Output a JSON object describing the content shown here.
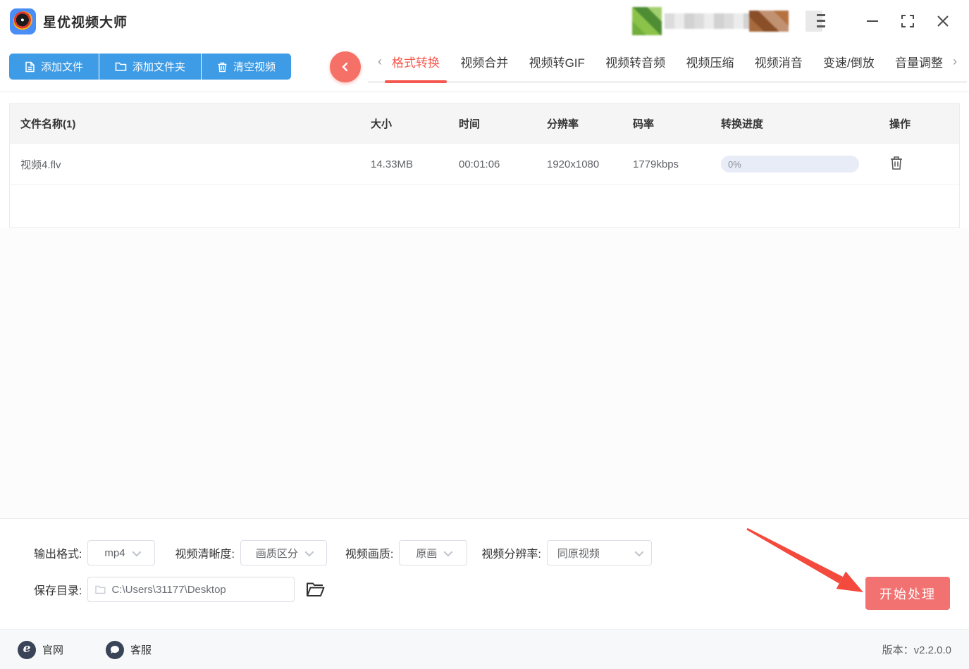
{
  "window": {
    "app_title": "星优视频大师",
    "controls": {
      "minimize": "minimize",
      "maximize": "maximize",
      "close": "close"
    }
  },
  "toolbar": {
    "add_file": "添加文件",
    "add_folder": "添加文件夹",
    "clear_videos": "清空视频"
  },
  "tabs": {
    "scroll_left": "‹",
    "scroll_right": "›",
    "items": [
      {
        "label": "格式转换",
        "active": true
      },
      {
        "label": "视频合并",
        "active": false
      },
      {
        "label": "视频转GIF",
        "active": false
      },
      {
        "label": "视频转音频",
        "active": false
      },
      {
        "label": "视频压缩",
        "active": false
      },
      {
        "label": "视频消音",
        "active": false
      },
      {
        "label": "变速/倒放",
        "active": false
      },
      {
        "label": "音量调整",
        "active": false
      }
    ]
  },
  "table": {
    "headers": [
      "文件名称(1)",
      "大小",
      "时间",
      "分辨率",
      "码率",
      "转换进度",
      "操作"
    ],
    "rows": [
      {
        "name": "视频4.flv",
        "size": "14.33MB",
        "duration": "00:01:06",
        "resolution": "1920x1080",
        "bitrate": "1779kbps",
        "progress_text": "0%",
        "progress_percent": 0
      }
    ]
  },
  "settings": {
    "output_format": {
      "label": "输出格式:",
      "value": "mp4"
    },
    "clarity": {
      "label": "视频清晰度:",
      "value": "画质区分"
    },
    "quality": {
      "label": "视频画质:",
      "value": "原画"
    },
    "resolution": {
      "label": "视频分辨率:",
      "value": "同原视频"
    },
    "save_dir": {
      "label": "保存目录:",
      "value": "C:\\Users\\31177\\Desktop"
    },
    "start_button": "开始处理"
  },
  "footer": {
    "official_site": "官网",
    "support": "客服",
    "version": "版本：v2.2.0.0"
  },
  "colors": {
    "toolbar_blue": "#3e9be5",
    "accent_red": "#f5584e",
    "back_circle_red": "#f57067",
    "start_button_red": "#f27272",
    "arrow_red": "#f4493d",
    "table_header_bg": "#f5f5f5",
    "progress_track": "#e8ecf7",
    "footer_bg": "#f7f8fa",
    "logo_blue": "#4a8df6"
  }
}
